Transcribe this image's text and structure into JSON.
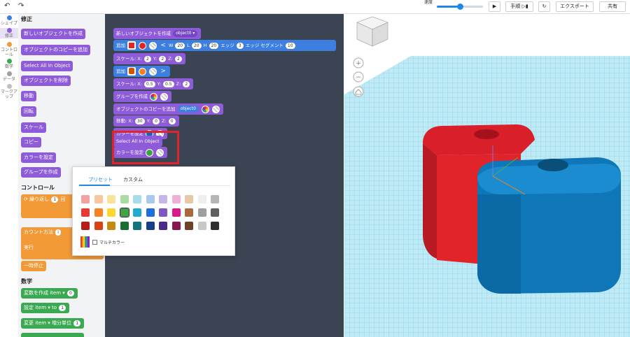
{
  "topbar": {
    "speed_label": "速度",
    "speed_value_fraction": 0.5,
    "steps_label": "手順",
    "export_label": "エクスポート",
    "share_label": "共有"
  },
  "categories": [
    {
      "label": "シェイプ",
      "color": "#3c7fe0"
    },
    {
      "label": "修正",
      "color": "#8e5bd9"
    },
    {
      "label": "コントロール",
      "color": "#f29a38"
    },
    {
      "label": "数学",
      "color": "#3ba852"
    },
    {
      "label": "データ",
      "color": "#a0a0a0"
    },
    {
      "label": "マークアップ",
      "color": "#c0c0c0"
    }
  ],
  "palette": {
    "modify_title": "修正",
    "modify_blocks": [
      "新しいオブジェクトを作成",
      "オブジェクトのコピーを追加",
      "Select All In Object",
      "オブジェクトを削除",
      "移動",
      "回転",
      "スケール",
      "コピー",
      "カラーを設定",
      "グループを作成"
    ],
    "control_title": "コントロール",
    "repeat_label": "繰り返し",
    "repeat_value": "1",
    "repeat_suffix": "回",
    "count_label": "カウント方法",
    "count_value": "i",
    "execute_label": "実行",
    "pause_label": "一時停止",
    "math_title": "数学",
    "var_create_label": "変数を作成",
    "var_create_name": "item",
    "var_create_value": "0",
    "set_label": "設定",
    "set_name": "item",
    "set_to": "to",
    "set_value": "1",
    "change_label": "変更",
    "change_name": "item",
    "change_by": "増分単位",
    "change_value": "1"
  },
  "workspace": {
    "b1_label": "新しいオブジェクトを作成",
    "b1_obj": "object0",
    "b2_label": "追加",
    "b2_w_label": "W",
    "b2_w": "20",
    "b2_l_label": "L",
    "b2_l": "20",
    "b2_h_label": "H",
    "b2_h": "20",
    "b2_edge_label": "エッジ",
    "b2_edge": "3",
    "b2_seg_label": "エッジ セグメント",
    "b2_seg": "10",
    "b3_label": "スケール:",
    "b3_x_label": "X:",
    "b3_x": "2",
    "b3_y_label": "Y:",
    "b3_y": "2",
    "b3_z_label": "Z:",
    "b3_z": "2",
    "b4_label": "追加",
    "b5_label": "スケール:",
    "b5_x_label": "X:",
    "b5_x": "0.5",
    "b5_y_label": "Y:",
    "b5_y": "0.5",
    "b5_z_label": "Z:",
    "b5_z": "2",
    "b6_label": "グループを作成",
    "b7_label": "オブジェクトのコピーを追加",
    "b7_obj": "object0",
    "b8_label": "移動:",
    "b8_x_label": "X:",
    "b8_x": "30",
    "b8_y_label": "Y:",
    "b8_y": "0",
    "b8_z_label": "Z:",
    "b8_z": "0",
    "b9_label": "カラーを設定",
    "b10_label": "Select All In Object",
    "b11_label": "カラーを設定"
  },
  "color_popup": {
    "tab_preset": "プリセット",
    "tab_custom": "カスタム",
    "multicolor_label": "マルチカラー",
    "rows": [
      [
        "#f0a2a0",
        "#f9c79f",
        "#f7e49a",
        "#a9dba3",
        "#a6dde9",
        "#a9c8ef",
        "#c5b5e8",
        "#efb0d7",
        "#e8c7a7",
        "#eeeeee",
        "#b5b5b5"
      ],
      [
        "#e53935",
        "#f58220",
        "#fdd835",
        "#43a047",
        "#26a9d0",
        "#1e6fd9",
        "#7e57c2",
        "#d81b8a",
        "#a86a3c",
        "#9e9e9e",
        "#5f5f5f"
      ],
      [
        "#b71c1c",
        "#d84315",
        "#c68a12",
        "#1b6e31",
        "#15737f",
        "#1a3f8a",
        "#4a2a8a",
        "#8a1650",
        "#6d4226",
        "#c8c8c8",
        "#2e2e2e"
      ]
    ]
  },
  "colors": {
    "accent": "#1e88e5",
    "highlight": "#e0242a",
    "red_box": "#e0242a",
    "blue_box": "#0f77b8"
  }
}
